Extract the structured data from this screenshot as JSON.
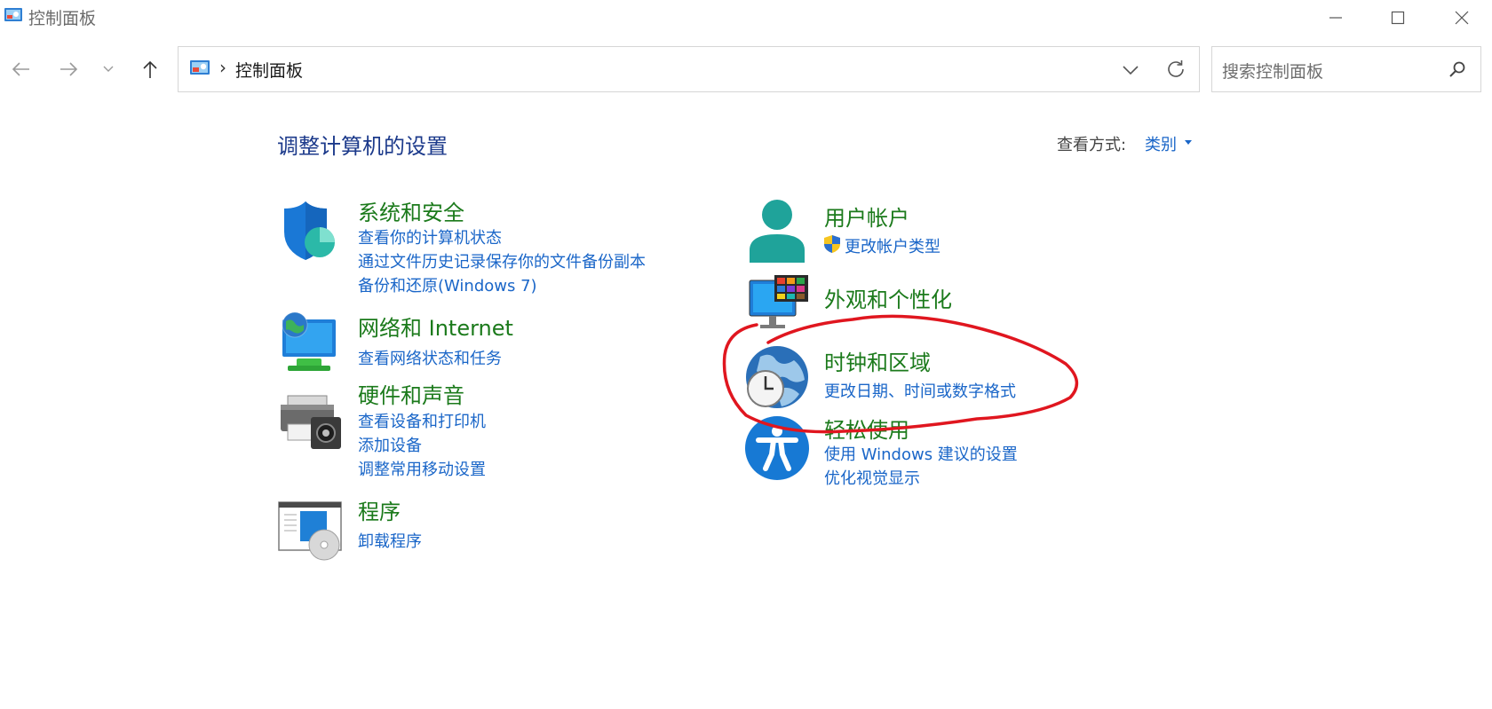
{
  "window": {
    "title": "控制面板",
    "minimize": "minimize",
    "maximize": "maximize",
    "close": "close"
  },
  "nav": {
    "back": "back",
    "forward": "forward",
    "recent": "recent",
    "up": "up"
  },
  "address": {
    "crumb": "控制面板",
    "separator": "›"
  },
  "search": {
    "placeholder": "搜索控制面板"
  },
  "header": {
    "title": "调整计算机的设置",
    "view_label": "查看方式:",
    "view_value": "类别"
  },
  "categories": {
    "system": {
      "title": "系统和安全",
      "links": [
        "查看你的计算机状态",
        "通过文件历史记录保存你的文件备份副本",
        "备份和还原(Windows 7)"
      ]
    },
    "network": {
      "title": "网络和 Internet",
      "links": [
        "查看网络状态和任务"
      ]
    },
    "hardware": {
      "title": "硬件和声音",
      "links": [
        "查看设备和打印机",
        "添加设备",
        "调整常用移动设置"
      ]
    },
    "programs": {
      "title": "程序",
      "links": [
        "卸载程序"
      ]
    },
    "user": {
      "title": "用户帐户",
      "links": [
        "更改帐户类型"
      ]
    },
    "appearance": {
      "title": "外观和个性化",
      "links": []
    },
    "clock": {
      "title": "时钟和区域",
      "links": [
        "更改日期、时间或数字格式"
      ]
    },
    "ease": {
      "title": "轻松使用",
      "links": [
        "使用 Windows 建议的设置",
        "优化视觉显示"
      ]
    }
  },
  "colors": {
    "category_title": "#1b7a1b",
    "link": "#1a66c8",
    "page_title": "#1c3a8b",
    "annotation": "#e0161f"
  },
  "icons": {
    "system": "shield-icon",
    "network": "network-monitor-icon",
    "hardware": "printer-icon",
    "programs": "programs-icon",
    "user": "user-icon",
    "appearance": "monitor-palette-icon",
    "clock": "globe-clock-icon",
    "ease": "accessibility-icon"
  }
}
